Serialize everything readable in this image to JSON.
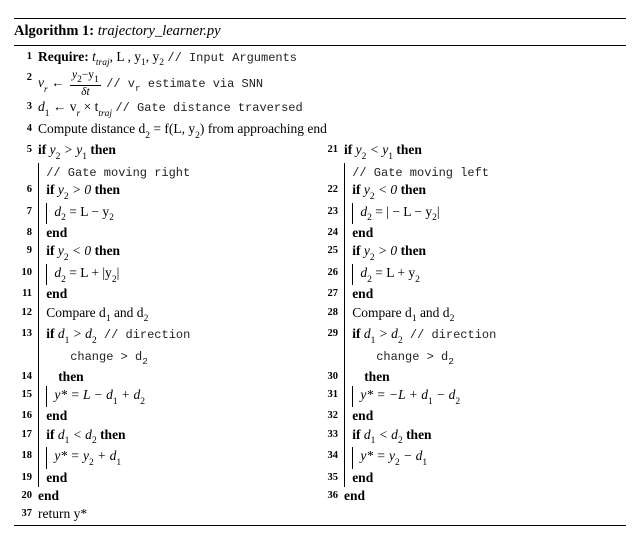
{
  "header": {
    "label": "Algorithm 1:",
    "title": "trajectory_learner.py"
  },
  "L1": {
    "kw": "Require:",
    "body": "t",
    "sub": "traj",
    "body2": ", L , y",
    "s1": "1",
    "body3": ", y",
    "s2": "2",
    "comment": "// Input Arguments"
  },
  "L2": {
    "lhs": "v",
    "lhsub": "r",
    "arrow": " ← ",
    "numa": "y",
    "nums1": "2",
    "numb": "−y",
    "nums2": "1",
    "den": "δt",
    "comment": "// v",
    "csub": "r",
    "crest": " estimate via SNN"
  },
  "L3": {
    "lhs": "d",
    "lhsub": "1",
    "arrow": " ← v",
    "rsub": "r",
    "mul": " × t",
    "tsub": "traj",
    "comment": " // Gate distance traversed"
  },
  "L4": {
    "text": "Compute distance d",
    "s1": "2",
    "mid": " = f(L, y",
    "s2": "2",
    "end": ") from approaching end"
  },
  "left": {
    "L5": {
      "kw": "if",
      "cond": " y",
      "s1": "2",
      "mid": " > y",
      "s2": "1",
      "then": " then"
    },
    "L5c": "// Gate moving right",
    "L6": {
      "kw": "if",
      "cond": " y",
      "s1": "2",
      "mid": " > 0 ",
      "then": "then"
    },
    "L7": {
      "eq": "d",
      "s1": "2",
      "rest": " = L − y",
      "s2": "2"
    },
    "L8": "end",
    "L9": {
      "kw": "if",
      "cond": " y",
      "s1": "2",
      "mid": " < 0 ",
      "then": "then"
    },
    "L10": {
      "eq": "d",
      "s1": "2",
      "rest": " = L + |y",
      "s2": "2",
      "end": "|"
    },
    "L11": "end",
    "L12": {
      "pre": "Compare d",
      "s1": "1",
      "mid": " and d",
      "s2": "2"
    },
    "L13": {
      "kw": "if",
      "cond": " d",
      "s1": "1",
      "mid": " > d",
      "s2": "2",
      "comment": " // direction"
    },
    "L13c1": "change > d",
    "L13c1s": "2",
    "L14": "then",
    "L15": {
      "eq": "y* = L − d",
      "s1": "1",
      "mid": " + d",
      "s2": "2"
    },
    "L16": "end",
    "L17": {
      "kw": "if",
      "cond": " d",
      "s1": "1",
      "mid": " < d",
      "s2": "2",
      "then": " then"
    },
    "L18": {
      "eq": "y* = y",
      "s1": "2",
      "mid": " + d",
      "s2": "1"
    },
    "L19": "end",
    "L20": "end"
  },
  "right": {
    "L21": {
      "kw": "if",
      "cond": " y",
      "s1": "2",
      "mid": " < y",
      "s2": "1",
      "then": " then"
    },
    "L21c": "// Gate moving left",
    "L22": {
      "kw": "if",
      "cond": " y",
      "s1": "2",
      "mid": " < 0 ",
      "then": "then"
    },
    "L23": {
      "eq": "d",
      "s1": "2",
      "rest": " = | − L − y",
      "s2": "2",
      "end": "|"
    },
    "L24": "end",
    "L25": {
      "kw": "if",
      "cond": " y",
      "s1": "2",
      "mid": " > 0 ",
      "then": "then"
    },
    "L26": {
      "eq": "d",
      "s1": "2",
      "rest": " = L + y",
      "s2": "2"
    },
    "L27": "end",
    "L28": {
      "pre": "Compare d",
      "s1": "1",
      "mid": " and d",
      "s2": "2"
    },
    "L29": {
      "kw": "if",
      "cond": " d",
      "s1": "1",
      "mid": " > d",
      "s2": "2",
      "comment": " // direction"
    },
    "L29c1": "change > d",
    "L29c1s": "2",
    "L30": "then",
    "L31": {
      "eq": "y* = −L + d",
      "s1": "1",
      "mid": " − d",
      "s2": "2"
    },
    "L32": "end",
    "L33": {
      "kw": "if",
      "cond": " d",
      "s1": "1",
      "mid": " < d",
      "s2": "2",
      "then": " then"
    },
    "L34": {
      "eq": "y* = y",
      "s1": "2",
      "mid": " − d",
      "s2": "1"
    },
    "L35": "end",
    "L36": "end"
  },
  "L37": "return y*"
}
